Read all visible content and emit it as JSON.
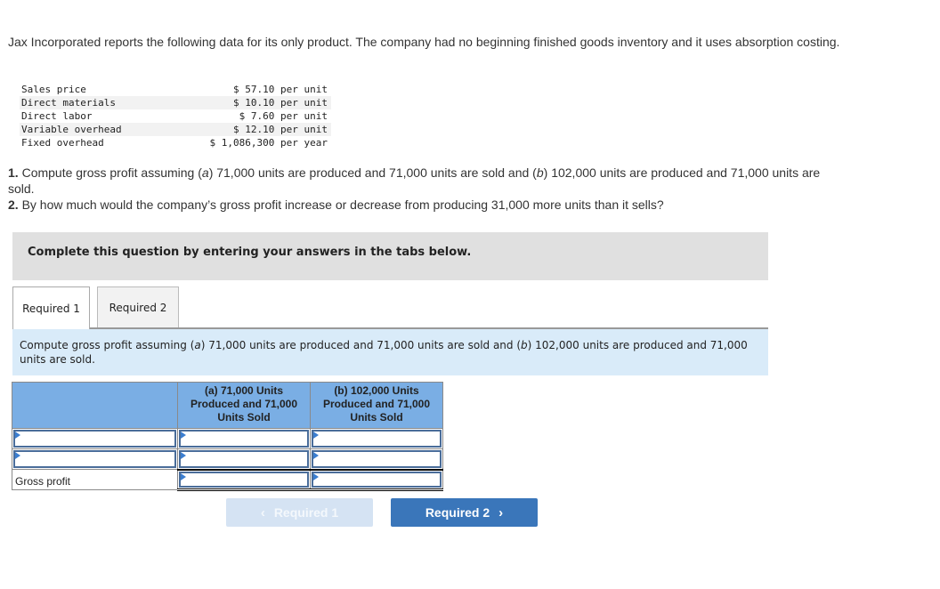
{
  "intro": "Jax Incorporated reports the following data for its only product. The company had no beginning finished goods inventory and it uses absorption costing.",
  "given_data": [
    {
      "label": "Sales price",
      "value": "$ 57.10",
      "unit": "per unit"
    },
    {
      "label": "Direct materials",
      "value": "$ 10.10",
      "unit": "per unit"
    },
    {
      "label": "Direct labor",
      "value": "$ 7.60",
      "unit": "per unit"
    },
    {
      "label": "Variable overhead",
      "value": "$ 12.10",
      "unit": "per unit"
    },
    {
      "label": "Fixed overhead",
      "value": "$ 1,086,300",
      "unit": "per year"
    }
  ],
  "questions": {
    "q1_num": "1.",
    "q1_a": " Compute gross profit assuming (",
    "q1_a_letter": "a",
    "q1_b": ") 71,000 units are produced and 71,000 units are sold and (",
    "q1_b_letter": "b",
    "q1_c": ") 102,000 units are produced and 71,000 units are sold.",
    "q2_num": "2.",
    "q2_text": " By how much would the company’s gross profit increase or decrease from producing 31,000 more units than it sells?"
  },
  "banner": "Complete this question by entering your answers in the tabs below.",
  "tabs": [
    {
      "label": "Required 1",
      "active": true
    },
    {
      "label": "Required 2",
      "active": false
    }
  ],
  "instruction": {
    "pre": "Compute gross profit assuming (",
    "a": "a",
    "mid": ") 71,000 units are produced and 71,000 units are sold and (",
    "b": "b",
    "post": ") 102,000 units are produced and 71,000 units are sold."
  },
  "table": {
    "headers": [
      "",
      "(a) 71,000 Units Produced and 71,000 Units Sold",
      "(b) 102,000 Units Produced and 71,000 Units Sold"
    ],
    "rows": [
      {
        "label": "",
        "values": [
          "",
          ""
        ]
      },
      {
        "label": "",
        "values": [
          "",
          ""
        ]
      },
      {
        "label": "Gross profit",
        "values": [
          "",
          ""
        ]
      }
    ]
  },
  "nav": {
    "prev_label": "Required 1",
    "next_label": "Required 2",
    "prev_icon": "‹",
    "next_icon": "›"
  }
}
